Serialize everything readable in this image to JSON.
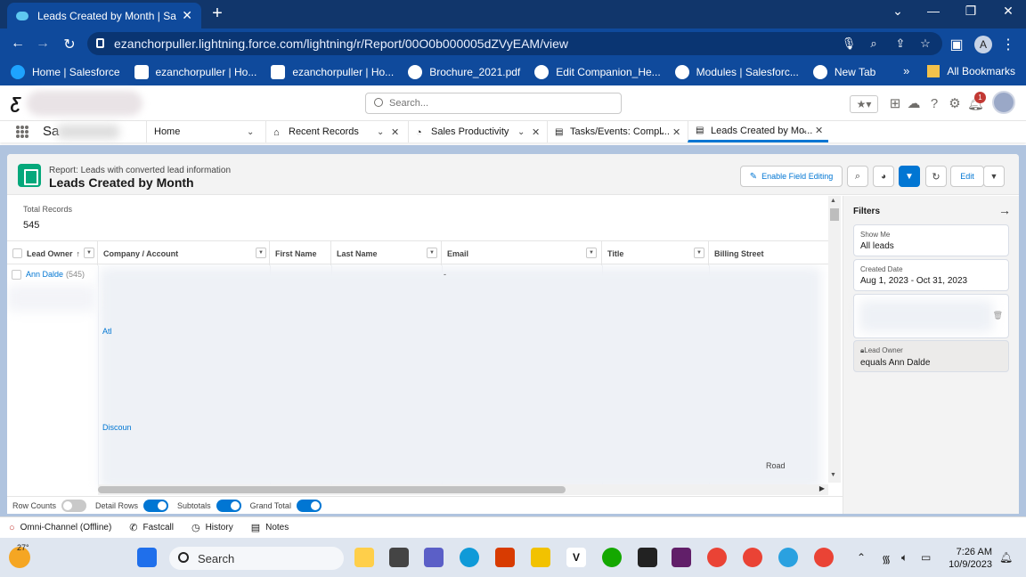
{
  "browser": {
    "tab_title": "Leads Created by Month | Salesf",
    "url": "ezanchorpuller.lightning.force.com/lightning/r/Report/00O0b000005dZVyEAM/view",
    "profile_initial": "A",
    "bookmarks": [
      {
        "label": "Home | Salesforce",
        "icon": "salesforce-cloud-icon",
        "color": "#1ea3ff"
      },
      {
        "label": "ezanchorpuller | Ho...",
        "icon": "ezanchor-icon",
        "color": "#ffffff"
      },
      {
        "label": "ezanchorpuller | Ho...",
        "icon": "ezanchor-icon",
        "color": "#ffffff"
      },
      {
        "label": "Brochure_2021.pdf",
        "icon": "globe-icon",
        "color": "#ffffff"
      },
      {
        "label": "Edit Companion_He...",
        "icon": "globe-icon",
        "color": "#ffffff"
      },
      {
        "label": "Modules | Salesforc...",
        "icon": "trailhead-icon",
        "color": "#ffffff"
      },
      {
        "label": "New Tab",
        "icon": "globe-icon",
        "color": "#ffffff"
      }
    ],
    "bookmarks_overflow": "»",
    "all_bookmarks": "All Bookmarks"
  },
  "sf": {
    "search_placeholder": "Search...",
    "app_name": "Sa",
    "notification_count": "1",
    "nav_tabs": [
      {
        "label": "Home",
        "icon": ""
      },
      {
        "label": "Recent Records",
        "icon": "home-icon"
      },
      {
        "label": "Sales Productivity",
        "icon": "speedometer-icon"
      },
      {
        "label": "Tasks/Events: Compl...",
        "icon": "report-icon"
      },
      {
        "label": "Leads Created by Mo...",
        "icon": "report-icon"
      }
    ]
  },
  "report": {
    "subtitle": "Report: Leads with converted lead information",
    "title": "Leads Created by Month",
    "enable_field_editing": "Enable Field Editing",
    "edit": "Edit",
    "total_records_label": "Total Records",
    "total_records_value": "545",
    "columns": [
      "Lead Owner",
      "Company / Account",
      "First Name",
      "Last Name",
      "Email",
      "Title",
      "Billing Street"
    ],
    "sort_indicator": "↑",
    "first_row": {
      "owner": "Ann Dalde",
      "count": "(545)",
      "email": "-"
    },
    "visible_fragments": {
      "company_1": "Atl",
      "company_2": "Discoun",
      "street": "Road"
    },
    "toggles": [
      {
        "label": "Row Counts",
        "on": false
      },
      {
        "label": "Detail Rows",
        "on": true
      },
      {
        "label": "Subtotals",
        "on": true
      },
      {
        "label": "Grand Total",
        "on": true
      }
    ]
  },
  "filters": {
    "title": "Filters",
    "items": [
      {
        "label": "Show Me",
        "value": "All leads"
      },
      {
        "label": "Created Date",
        "value": "Aug 1, 2023 - Oct 31, 2023"
      },
      {
        "label": "Lead Owner",
        "value": "equals Ann Dalde"
      }
    ]
  },
  "utility": [
    {
      "label": "Omni-Channel (Offline)",
      "icon": "offline-circle-icon"
    },
    {
      "label": "Fastcall",
      "icon": "phone-icon"
    },
    {
      "label": "History",
      "icon": "clock-icon"
    },
    {
      "label": "Notes",
      "icon": "notes-icon"
    }
  ],
  "taskbar": {
    "temperature": "27°",
    "search": "Search",
    "time": "7:26 AM",
    "date": "10/9/2023",
    "app_colors": [
      "#1f6feb",
      "#444444",
      "#5b5fc7",
      "#0f9ad8",
      "#d83b01",
      "#f2c200",
      "#111111",
      "#14a800",
      "#222222",
      "#611f69",
      "#ea4335",
      "#ea4335",
      "#2aa1e0",
      "#ea4335"
    ]
  }
}
